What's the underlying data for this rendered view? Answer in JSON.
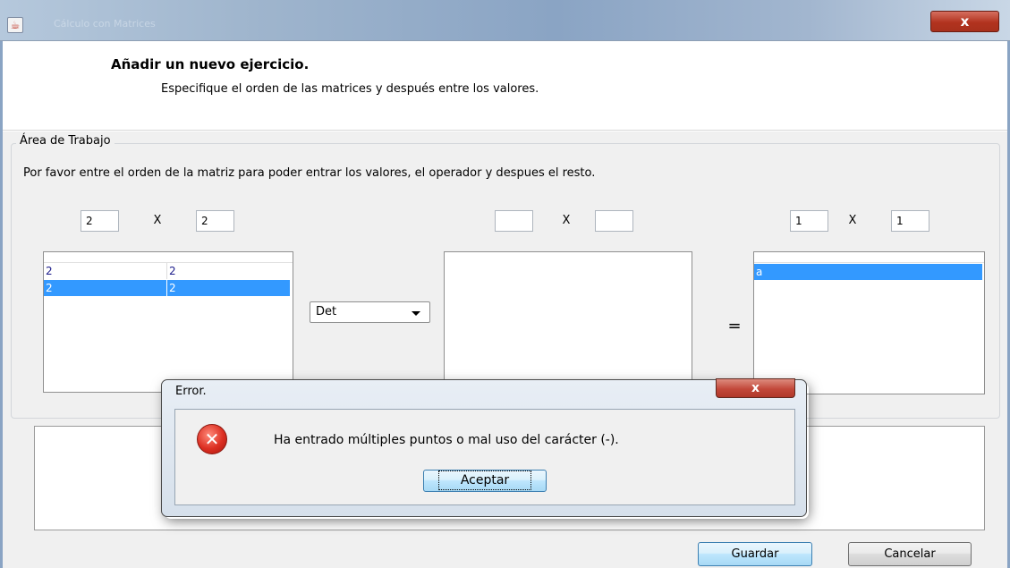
{
  "window": {
    "title": "Cálculo con Matrices",
    "close_label": "x"
  },
  "header": {
    "title": "Añadir un nuevo ejercicio.",
    "subtitle": "Especifique el orden de las matrices y después entre los valores."
  },
  "workarea": {
    "legend": "Área de Trabajo",
    "instructions": "Por favor entre el orden de la matriz para poder entrar los valores, el operador y despues el resto.",
    "x_symbol": "X",
    "equals": "="
  },
  "matrix_a": {
    "rows_value": "2",
    "cols_value": "2",
    "cells": [
      [
        "2",
        "2"
      ],
      [
        "2",
        "2"
      ]
    ],
    "selected_row": 1
  },
  "operator": {
    "selected": "Det"
  },
  "matrix_b": {
    "rows_value": "",
    "cols_value": "",
    "cells": []
  },
  "matrix_result": {
    "rows_value": "1",
    "cols_value": "1",
    "cells": [
      [
        "a"
      ]
    ],
    "selected_row": 0
  },
  "buttons": {
    "save": "Guardar",
    "cancel": "Cancelar"
  },
  "error_dialog": {
    "title": "Error.",
    "close_label": "x",
    "message": "Ha entrado múltiples puntos o mal uso del carácter (-).",
    "ok": "Aceptar"
  },
  "colors": {
    "selection": "#3399ff",
    "error_red": "#dc2f22",
    "title_bar": "#8aa4c4"
  }
}
